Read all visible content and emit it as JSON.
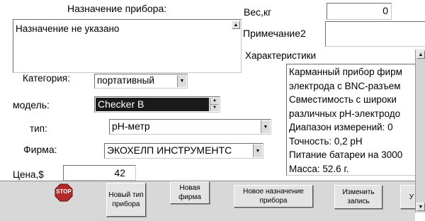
{
  "purpose": {
    "label": "Назначение прибора:",
    "value": "Назначение не указано"
  },
  "weight": {
    "label": "Вес,кг",
    "value": "0"
  },
  "note2": {
    "label": "Примечание2",
    "value": ""
  },
  "characteristics": {
    "label": "Характеристики",
    "lines": [
      "Карманный прибор фирм",
      "электрода с BNC-разъем",
      "Свместимость с широки",
      "различных pH-электродо",
      "Диапазон измерений: 0",
      "Точность: 0,2 pH",
      "Питание батареи на 3000",
      "Масса: 52.6 г."
    ]
  },
  "category": {
    "label": "Категория:",
    "value": "портативный"
  },
  "model": {
    "label": "модель:",
    "value": "Checker B"
  },
  "type": {
    "label": "тип:",
    "value": "pH-метр"
  },
  "firm": {
    "label": "Фирма:",
    "value": "ЭКОХЕЛП ИНСТРУМЕНТС"
  },
  "price": {
    "label": "Цена,$",
    "value": "42"
  },
  "buttons": {
    "stop": "STOP",
    "new_type": "Новый тип прибора",
    "new_firm": "Новая фирма",
    "new_purpose": "Новое назначение прибора",
    "edit_record": "Изменить запись",
    "cut_off": "У"
  },
  "icons": {
    "stop": "stop-sign-icon",
    "scroll_up": "up-arrow-icon",
    "scroll_down": "down-arrow-icon",
    "dropdown": "dropdown-arrow-icon"
  },
  "colors": {
    "model_selection": "#1a1a1a",
    "toolbar_bg": "#d8d8d8",
    "stop_red": "#b22a2a"
  }
}
